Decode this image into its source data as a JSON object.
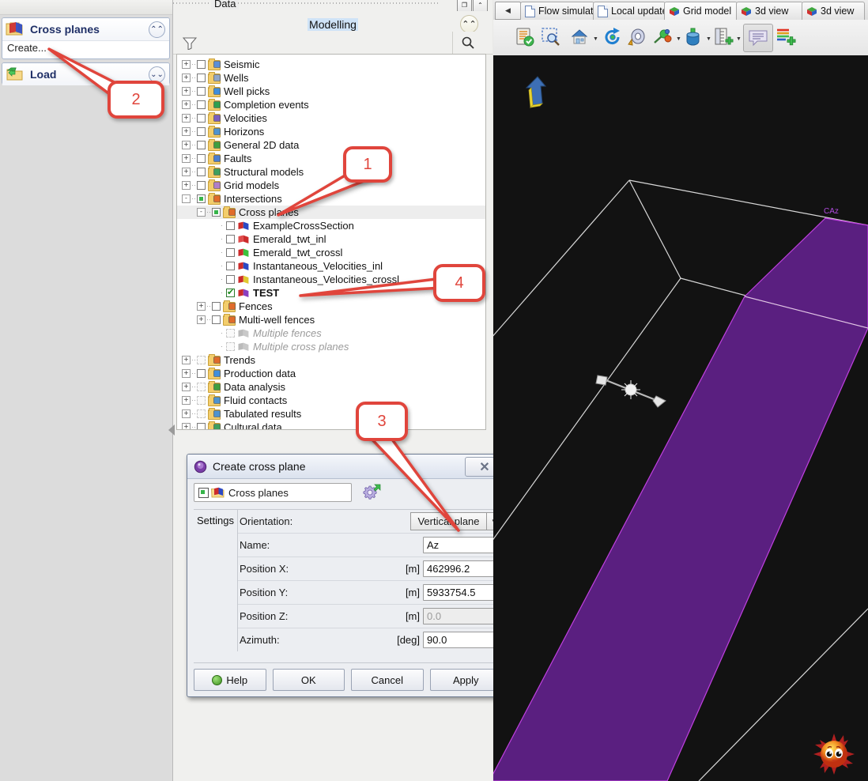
{
  "left_panel": {
    "sections": [
      {
        "title": "Cross planes",
        "icon": "cross-planes-folder-icon",
        "chevron": "collapse-chevron",
        "link": "Create..."
      },
      {
        "title": "Load",
        "icon": "load-folder-icon",
        "chevron": "expand-chevron"
      }
    ]
  },
  "center_panel": {
    "data_tab_label": "Data",
    "modelling_title": "Modelling",
    "collapse_chevron": "collapse-chevron-icon",
    "filter_icon": "funnel-icon",
    "search_icon": "search-icon",
    "tree": [
      {
        "label": "Seismic",
        "depth": 0,
        "expander": "+",
        "check": "empty",
        "icon": "seismic-folder-icon",
        "icon_color": "#5b8fd6"
      },
      {
        "label": "Wells",
        "depth": 0,
        "expander": "+",
        "check": "empty",
        "icon": "wells-folder-icon",
        "icon_color": "#8fa6c9"
      },
      {
        "label": "Well picks",
        "depth": 0,
        "expander": "+",
        "check": "empty",
        "icon": "well-picks-folder-icon",
        "icon_color": "#3f8edc"
      },
      {
        "label": "Completion events",
        "depth": 0,
        "expander": "+",
        "check": "empty",
        "icon": "completion-events-folder-icon",
        "icon_color": "#2f9f4f"
      },
      {
        "label": "Velocities",
        "depth": 0,
        "expander": "+",
        "check": "empty",
        "icon": "velocities-folder-icon",
        "icon_color": "#7a5fc0"
      },
      {
        "label": "Horizons",
        "depth": 0,
        "expander": "+",
        "check": "empty",
        "icon": "horizons-folder-icon",
        "icon_color": "#4f93cf"
      },
      {
        "label": "General 2D data",
        "depth": 0,
        "expander": "+",
        "check": "empty",
        "icon": "general-2d-data-folder-icon",
        "icon_color": "#3f9f3f"
      },
      {
        "label": "Faults",
        "depth": 0,
        "expander": "+",
        "check": "empty",
        "icon": "faults-folder-icon",
        "icon_color": "#4b7fd0"
      },
      {
        "label": "Structural models",
        "depth": 0,
        "expander": "+",
        "check": "empty",
        "icon": "structural-models-folder-icon",
        "icon_color": "#3f9f5f"
      },
      {
        "label": "Grid models",
        "depth": 0,
        "expander": "+",
        "check": "empty",
        "icon": "grid-models-folder-icon",
        "icon_color": "#b07fc9"
      },
      {
        "label": "Intersections",
        "depth": 0,
        "expander": "-",
        "check": "green",
        "icon": "intersections-folder-icon",
        "icon_color": "#e06b2a"
      },
      {
        "label": "Cross planes",
        "depth": 1,
        "expander": "-",
        "check": "green",
        "icon": "cross-planes-folder-icon",
        "icon_color": "#e06b2a",
        "selected": true
      },
      {
        "label": "ExampleCrossSection",
        "depth": 2,
        "expander": "",
        "check": "empty",
        "icon": "cross-plane-icon",
        "icon_color": "#2c49c4",
        "icon_color2": "#cc2b2b"
      },
      {
        "label": "Emerald_twt_inl",
        "depth": 2,
        "expander": "",
        "check": "empty",
        "icon": "cross-plane-icon",
        "icon_color": "#cc2b2b",
        "icon_color2": "#e04b4b"
      },
      {
        "label": "Emerald_twt_crossl",
        "depth": 2,
        "expander": "",
        "check": "empty",
        "icon": "cross-plane-icon",
        "icon_color": "#3cc23c",
        "icon_color2": "#cc2b2b"
      },
      {
        "label": "Instantaneous_Velocities_inl",
        "depth": 2,
        "expander": "",
        "check": "empty",
        "icon": "cross-plane-icon",
        "icon_color": "#2c49c4",
        "icon_color2": "#cc2b2b"
      },
      {
        "label": "Instantaneous_Velocities_crossl",
        "depth": 2,
        "expander": "",
        "check": "empty",
        "icon": "cross-plane-icon",
        "icon_color": "#e0c832",
        "icon_color2": "#cc2b2b"
      },
      {
        "label": "TEST",
        "depth": 2,
        "expander": "",
        "check": "checked",
        "icon": "cross-plane-icon",
        "icon_color": "#8a3fc0",
        "icon_color2": "#cc2b2b",
        "bold": true
      },
      {
        "label": "Fences",
        "depth": 1,
        "expander": "+",
        "check": "empty",
        "icon": "fences-folder-icon",
        "icon_color": "#e06b2a"
      },
      {
        "label": "Multi-well fences",
        "depth": 1,
        "expander": "+",
        "check": "empty",
        "icon": "multi-well-fences-folder-icon",
        "icon_color": "#e06b2a"
      },
      {
        "label": "Multiple fences",
        "depth": 2,
        "expander": "",
        "check": "ghost",
        "icon": "multiple-fences-icon",
        "icon_color": "#c9c9c9",
        "disabled": true
      },
      {
        "label": "Multiple cross planes",
        "depth": 2,
        "expander": "",
        "check": "ghost",
        "icon": "multiple-cross-planes-icon",
        "icon_color": "#c9c9c9",
        "disabled": true
      },
      {
        "label": "Trends",
        "depth": 0,
        "expander": "+",
        "check": "ghost",
        "icon": "trends-folder-icon",
        "icon_color": "#e06b2a"
      },
      {
        "label": "Production data",
        "depth": 0,
        "expander": "+",
        "check": "empty",
        "icon": "production-data-folder-icon",
        "icon_color": "#3f8edc"
      },
      {
        "label": "Data analysis",
        "depth": 0,
        "expander": "+",
        "check": "ghost",
        "icon": "data-analysis-folder-icon",
        "icon_color": "#3f9f3f"
      },
      {
        "label": "Fluid contacts",
        "depth": 0,
        "expander": "+",
        "check": "ghost",
        "icon": "fluid-contacts-folder-icon",
        "icon_color": "#4f93cf"
      },
      {
        "label": "Tabulated results",
        "depth": 0,
        "expander": "+",
        "check": "ghost",
        "icon": "tabulated-results-folder-icon",
        "icon_color": "#4f93cf"
      },
      {
        "label": "Cultural data",
        "depth": 0,
        "expander": "+",
        "check": "empty",
        "icon": "cultural-data-folder-icon",
        "icon_color": "#3f9f5f"
      }
    ]
  },
  "dialog": {
    "title": "Create cross plane",
    "title_icon": "cross-plane-dialog-icon",
    "close_label": "✕",
    "object_combo": {
      "label": "Cross planes",
      "icon": "cross-planes-icon"
    },
    "gear_icon": "settings-gear-icon",
    "settings_tab": "Settings",
    "fields": [
      {
        "label": "Orientation:",
        "unit": "",
        "value": "Vertical plane",
        "type": "combo"
      },
      {
        "label": "Name:",
        "unit": "",
        "value": "Az",
        "type": "text"
      },
      {
        "label": "Position X:",
        "unit": "[m]",
        "value": "462996.2",
        "type": "text"
      },
      {
        "label": "Position Y:",
        "unit": "[m]",
        "value": "5933754.5",
        "type": "text"
      },
      {
        "label": "Position Z:",
        "unit": "[m]",
        "value": "0.0",
        "type": "text-readonly"
      },
      {
        "label": "Azimuth:",
        "unit": "[deg]",
        "value": "90.0",
        "type": "text"
      }
    ],
    "buttons": [
      {
        "label": "Help",
        "icon": "help-icon"
      },
      {
        "label": "OK",
        "icon": ""
      },
      {
        "label": "Cancel",
        "icon": ""
      },
      {
        "label": "Apply",
        "icon": ""
      }
    ]
  },
  "right_panel": {
    "tab_scroll_left": "◀",
    "tabs": [
      {
        "label": "Flow simulat",
        "icon": "document-icon",
        "active": false
      },
      {
        "label": "Local update",
        "icon": "document-icon",
        "active": false
      },
      {
        "label": "Grid model",
        "icon": "cube-icon",
        "active": true
      },
      {
        "label": "3d view",
        "icon": "cube-icon",
        "active": false
      },
      {
        "label": "3d view",
        "icon": "cube-icon",
        "active": false
      }
    ],
    "toolbar": [
      {
        "name": "checklist-icon",
        "dropdown": false
      },
      {
        "name": "zoom-select-icon",
        "dropdown": false
      },
      {
        "name": "home-view-icon",
        "dropdown": true
      },
      {
        "name": "rotate-icon",
        "dropdown": false
      },
      {
        "name": "measure-icon",
        "dropdown": false
      },
      {
        "name": "pin-tool-icon",
        "dropdown": true
      },
      {
        "name": "well-tool-icon",
        "dropdown": true
      },
      {
        "name": "add-scale-icon",
        "dropdown": true
      },
      {
        "name": "annotation-icon",
        "dropdown": false,
        "active": true
      },
      {
        "name": "legend-add-icon",
        "dropdown": false
      }
    ],
    "view3d": {
      "north_arrow_icon": "north-arrow-icon",
      "sun_icon": "sun-light-icon",
      "plane_label": "CAz",
      "plane_color": "#5a1f80",
      "plane_edge_color": "#c040e0",
      "wire_color": "#d8d8d8",
      "background": "#121212",
      "manipulator_icon": "plane-manipulator-handle"
    }
  },
  "callouts": [
    {
      "number": "1"
    },
    {
      "number": "2"
    },
    {
      "number": "3"
    },
    {
      "number": "4"
    }
  ],
  "splitter_arrow_icon": "collapse-left-arrow-icon"
}
